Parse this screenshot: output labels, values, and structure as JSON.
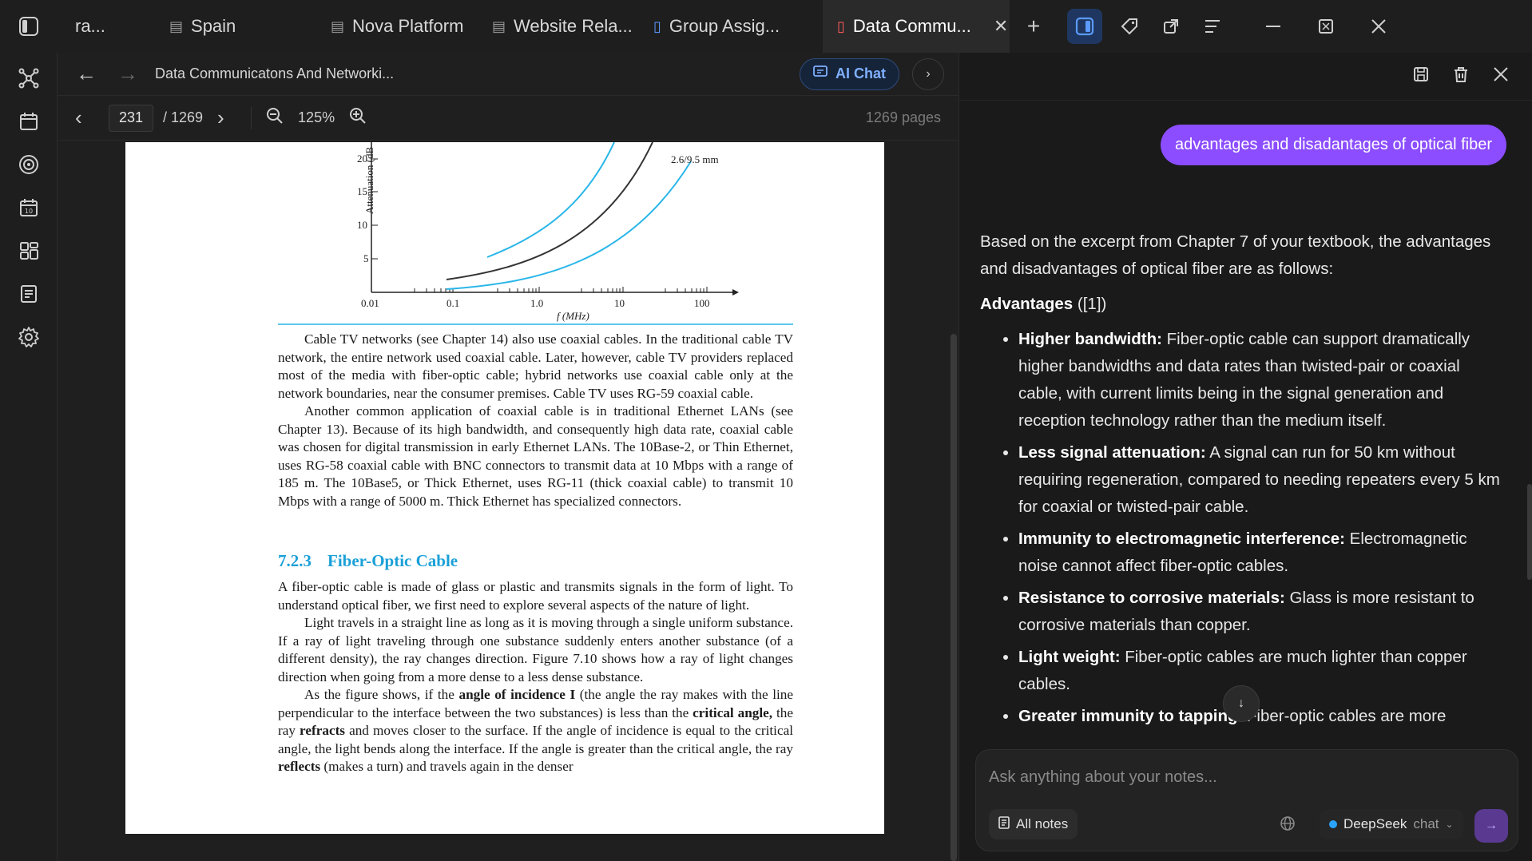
{
  "tabs": [
    {
      "label": "ra...",
      "icon": "none"
    },
    {
      "label": "Spain",
      "icon": "note-icon"
    },
    {
      "label": "Nova Platform",
      "icon": "note-icon"
    },
    {
      "label": "Website Rela...",
      "icon": "note-icon"
    },
    {
      "label": "Group Assig...",
      "icon": "file-icon"
    },
    {
      "label": "Data Commu...",
      "icon": "pdf-icon",
      "active": true
    }
  ],
  "doc": {
    "title": "Data Communicatons And Networki...",
    "ai_chat_label": "AI Chat",
    "page_current": "231",
    "page_total": "/ 1269",
    "zoom": "125%",
    "pages_info": "1269 pages"
  },
  "page": {
    "chart": {
      "ylabel": "Attenuation (dB",
      "xlabel": "f (MHz)",
      "curve_label": "2.6/9.5 mm",
      "yticks": [
        "20",
        "15",
        "10",
        "5"
      ],
      "xticks": [
        "0.01",
        "0.1",
        "1.0",
        "10",
        "100"
      ]
    },
    "para1": "Cable TV networks (see Chapter 14) also use coaxial cables. In the traditional cable TV network, the entire network used coaxial cable. Later, however, cable TV providers replaced most of the media with fiber-optic cable; hybrid networks use coaxial cable only at the network boundaries, near the consumer premises. Cable TV uses RG-59 coaxial cable.",
    "para2": "Another common application of coaxial cable is in traditional Ethernet LANs (see Chapter 13). Because of its high bandwidth, and consequently high data rate, coaxial cable was chosen for digital transmission in early Ethernet LANs. The 10Base-2, or Thin Ethernet, uses RG-58 coaxial cable with BNC connectors to transmit data at 10 Mbps with a range of 185 m. The 10Base5, or Thick Ethernet, uses RG-11 (thick coaxial cable) to transmit 10 Mbps with a range of 5000 m. Thick Ethernet has specialized connectors.",
    "section_num": "7.2.3",
    "section_title": "Fiber-Optic Cable",
    "para3": "A fiber-optic cable is made of glass or plastic and transmits signals in the form of light. To understand optical fiber, we first need to explore several aspects of the nature of light.",
    "para4": "Light travels in a straight line as long as it is moving through a single uniform substance. If a ray of light traveling through one substance suddenly enters another substance (of a different density), the ray changes direction. Figure 7.10 shows how a ray of light changes direction when going from a more dense to a less dense substance.",
    "para5_a": "As the figure shows, if the ",
    "para5_b": "angle of incidence I",
    "para5_c": " (the angle the ray makes with the line perpendicular to the interface between the two substances) is less than the ",
    "para5_d": "critical angle,",
    "para5_e": " the ray ",
    "para5_f": "refracts",
    "para5_g": " and moves closer to the surface. If the angle of incidence is equal to the critical angle, the light bends along the interface. If the angle is greater than the critical angle, the ray ",
    "para5_h": "reflects",
    "para5_i": " (makes a turn) and travels again in the denser"
  },
  "chat": {
    "user_message": "advantages and disadantages of optical fiber",
    "intro": "Based on the excerpt from Chapter 7 of your textbook, the advantages and disadvantages of optical fiber are as follows:",
    "adv_heading": "Advantages",
    "adv_ref": " ([1])",
    "items": [
      {
        "title": "Higher bandwidth:",
        "text": " Fiber-optic cable can support dramatically higher bandwidths and data rates than twisted-pair or coaxial cable, with current limits being in the signal generation and reception technology rather than the medium itself."
      },
      {
        "title": "Less signal attenuation:",
        "text": " A signal can run for 50 km without requiring regeneration, compared to needing repeaters every 5 km for coaxial or twisted-pair cable."
      },
      {
        "title": "Immunity to electromagnetic interference:",
        "text": " Electromagnetic noise cannot affect fiber-optic cables."
      },
      {
        "title": "Resistance to corrosive materials:",
        "text": " Glass is more resistant to corrosive materials than copper."
      },
      {
        "title": "Light weight:",
        "text": " Fiber-optic cables are much lighter than copper cables."
      },
      {
        "title": "Greater immunity to tapping.",
        "text": " Fiber-optic cables are more"
      }
    ],
    "input_placeholder": "Ask anything about your notes...",
    "scope_label": "All notes",
    "model_name": "DeepSeek",
    "model_mode": "chat"
  },
  "colors": {
    "accent": "#8b4dff",
    "link": "#7fb0ff",
    "section": "#1aa0d8",
    "curve_blue": "#29b6e8"
  }
}
